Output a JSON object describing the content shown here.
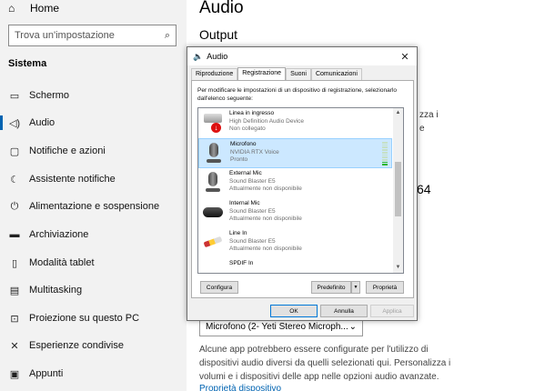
{
  "sidebar": {
    "home_label": "Home",
    "search_placeholder": "Trova un'impostazione",
    "section_label": "Sistema",
    "items": [
      {
        "label": "Schermo",
        "icon": "monitor-icon"
      },
      {
        "label": "Audio",
        "icon": "speaker-icon",
        "active": true
      },
      {
        "label": "Notifiche e azioni",
        "icon": "notification-icon"
      },
      {
        "label": "Assistente notifiche",
        "icon": "moon-icon"
      },
      {
        "label": "Alimentazione e sospensione",
        "icon": "power-icon"
      },
      {
        "label": "Archiviazione",
        "icon": "storage-icon"
      },
      {
        "label": "Modalità tablet",
        "icon": "tablet-icon"
      },
      {
        "label": "Multitasking",
        "icon": "multitasking-icon"
      },
      {
        "label": "Proiezione su questo PC",
        "icon": "projection-icon"
      },
      {
        "label": "Esperienze condivise",
        "icon": "shared-icon"
      },
      {
        "label": "Appunti",
        "icon": "clipboard-icon"
      }
    ]
  },
  "main": {
    "title": "Audio",
    "subtitle": "Output",
    "peek_1": "zza i",
    "peek_2": "e",
    "peek_3": "64",
    "input_device": "Microfono (2- Yeti Stereo Microph...",
    "description": "Alcune app potrebbero essere configurate per l'utilizzo di dispositivi audio diversi da quelli selezionati qui. Personalizza i volumi e i dispositivi delle app nelle opzioni audio avanzate.",
    "link": "Proprietà dispositivo"
  },
  "dialog": {
    "title": "Audio",
    "tabs": [
      "Riproduzione",
      "Registrazione",
      "Suoni",
      "Comunicazioni"
    ],
    "selected_tab": "Registrazione",
    "intro": "Per modificare le impostazioni di un dispositivo di registrazione, selezionarlo dall'elenco seguente:",
    "devices": [
      {
        "name": "Linea in ingresso",
        "driver": "High Definition Audio Device",
        "status": "Non collegato"
      },
      {
        "name": "Microfono",
        "driver": "NVIDIA RTX Voice",
        "status": "Pronto",
        "selected": true,
        "level": 0.2
      },
      {
        "name": "External Mic",
        "driver": "Sound Blaster E5",
        "status": "Attualmente non disponibile"
      },
      {
        "name": "Internal Mic",
        "driver": "Sound Blaster E5",
        "status": "Attualmente non disponibile"
      },
      {
        "name": "Line In",
        "driver": "Sound Blaster E5",
        "status": "Attualmente non disponibile"
      },
      {
        "name": "SPDIF In",
        "driver": "",
        "status": ""
      }
    ],
    "configure_label": "Configura",
    "default_label": "Predefinito",
    "properties_label": "Proprietà",
    "ok_label": "OK",
    "cancel_label": "Annulla",
    "apply_label": "Applica"
  },
  "colors": {
    "accent": "#0063b1",
    "selection": "#cce8ff",
    "meter": "#2eb82e"
  }
}
